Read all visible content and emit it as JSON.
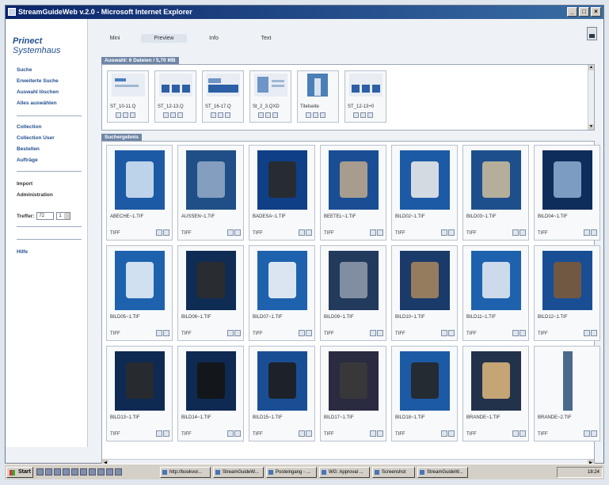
{
  "window": {
    "title": "StreamGuideWeb v.2.0 - Microsoft Internet Explorer",
    "controls": [
      "_",
      "□",
      "×"
    ]
  },
  "brand": {
    "strong": "Prinect",
    "rest": "Systemhaus"
  },
  "sidebar": {
    "group1": [
      "Suche",
      "Erweiterte Suche",
      "Auswahl löschen",
      "Alles auswählen"
    ],
    "group2": [
      "Collection",
      "Collection User",
      "Bestellen",
      "Aufträge"
    ],
    "group3": [
      "Import",
      "Administration"
    ],
    "treffer": {
      "label": "Treffer:",
      "value1": "72",
      "value2": "1"
    },
    "help": "Hilfe"
  },
  "tabs": [
    "Mini",
    "Preview",
    "Info",
    "Text"
  ],
  "active_tab": "Preview",
  "selection": {
    "header": "Auswahl: 6 Dateien / 5,70 MB",
    "items": [
      {
        "label": "ST_10-11.Q"
      },
      {
        "label": "ST_12-13.Q"
      },
      {
        "label": "ST_16-17.Q"
      },
      {
        "label": "St_2_3.QXD"
      },
      {
        "label": "Titelseite"
      },
      {
        "label": "ST_12-13+0"
      }
    ]
  },
  "results": {
    "header": "Suchergebnis",
    "items": [
      {
        "name": "ABECHE~1.TIF",
        "format": "TIFF"
      },
      {
        "name": "AUSSEN~1.TIF",
        "format": "TIFF"
      },
      {
        "name": "BADESA~1.TIF",
        "format": "TIFF"
      },
      {
        "name": "BEETEL~1.TIF",
        "format": "TIFF"
      },
      {
        "name": "BILD02~1.TIF",
        "format": "TIFF"
      },
      {
        "name": "BILD03~1.TIF",
        "format": "TIFF"
      },
      {
        "name": "BILD04~1.TIF",
        "format": "TIFF"
      },
      {
        "name": "BILD05~1.TIF",
        "format": "TIFF"
      },
      {
        "name": "BILD06~1.TIF",
        "format": "TIFF"
      },
      {
        "name": "BILD07~1.TIF",
        "format": "TIFF"
      },
      {
        "name": "BILD09~1.TIF",
        "format": "TIFF"
      },
      {
        "name": "BILD10~1.TIF",
        "format": "TIFF"
      },
      {
        "name": "BILD11~1.TIF",
        "format": "TIFF"
      },
      {
        "name": "BILD12~1.TIF",
        "format": "TIFF"
      },
      {
        "name": "BILD13~1.TIF",
        "format": "TIFF"
      },
      {
        "name": "BILD14~1.TIF",
        "format": "TIFF"
      },
      {
        "name": "BILD15~1.TIF",
        "format": "TIFF"
      },
      {
        "name": "BILD17~1.TIF",
        "format": "TIFF"
      },
      {
        "name": "BILD18~1.TIF",
        "format": "TIFF"
      },
      {
        "name": "BRANDE~1.TIF",
        "format": "TIFF"
      },
      {
        "name": "BRANDE~2.TIF",
        "format": "TIFF"
      }
    ]
  },
  "taskbar": {
    "start": "Start",
    "buttons": [
      "http://bookvor...",
      "StreamGuideW...",
      "Posteingang - ...",
      "WG: Approval ...",
      "Screenshot",
      "StreamGuideW..."
    ],
    "clock": "18:24"
  }
}
